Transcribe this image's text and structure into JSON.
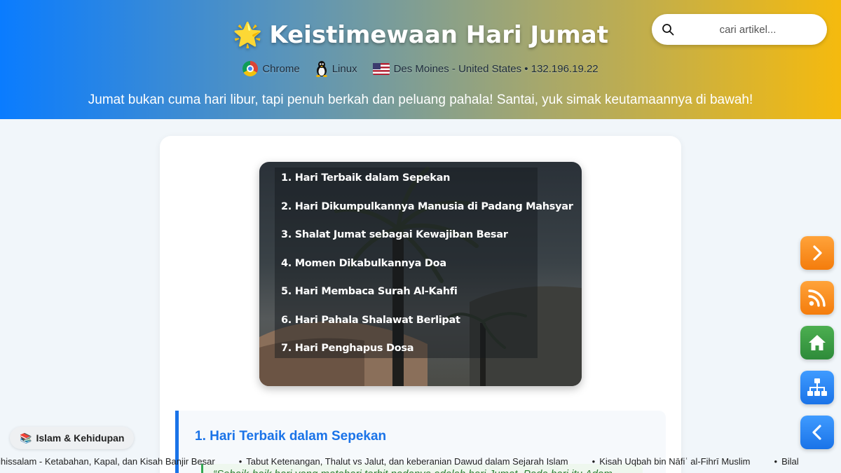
{
  "header": {
    "title_icon": "star-emoji",
    "title": "Keistimewaan Hari Jumat",
    "browser": "Chrome",
    "os": "Linux",
    "location": "Des Moines - United States • 132.196.19.22",
    "tagline": "Jumat bukan cuma hari libur, tapi penuh berkah dan peluang pahala! Santai, yuk simak keutamaannya di bawah!"
  },
  "search": {
    "placeholder": "cari artikel..."
  },
  "hero": {
    "items": [
      "1. Hari Terbaik dalam Sepekan",
      "2. Hari Dikumpulkannya Manusia di Padang Mahsyar",
      "3. Shalat Jumat sebagai Kewajiban Besar",
      "4. Momen Dikabulkannya Doa",
      "5. Hari Membaca Surah Al-Kahfi",
      "6. Hari Pahala Shalawat Berlipat",
      "7. Hari Penghapus Dosa"
    ]
  },
  "section": {
    "heading": "1. Hari Terbaik dalam Sepekan",
    "quote": "“Sebaik-baik hari yang matahari terbit padanya adalah hari Jumat. Pada hari itu Adam"
  },
  "category": {
    "icon": "books-emoji",
    "label": "Islam & Kehidupan"
  },
  "ticker": {
    "items": [
      "laihissalam - Ketabahan, Kapal, dan Kisah Banjir Besar",
      "Tabut Ketenangan, Thalut vs Jalut, dan keberanian Dawud dalam Sejarah Islam",
      "Kisah Uqbah bin Nāfiʿ al-Fihrī Muslim",
      "Bilal"
    ]
  },
  "sidebar_buttons": [
    "chevron-right-icon",
    "rss-icon",
    "home-icon",
    "sitemap-icon",
    "chevron-left-icon"
  ],
  "colors": {
    "accent_blue": "#1a73e8",
    "accent_orange": "#f47c0c",
    "accent_green": "#2e8b3a",
    "header_gradient_start": "#0a7cff",
    "header_gradient_end": "#f5ba0e"
  }
}
